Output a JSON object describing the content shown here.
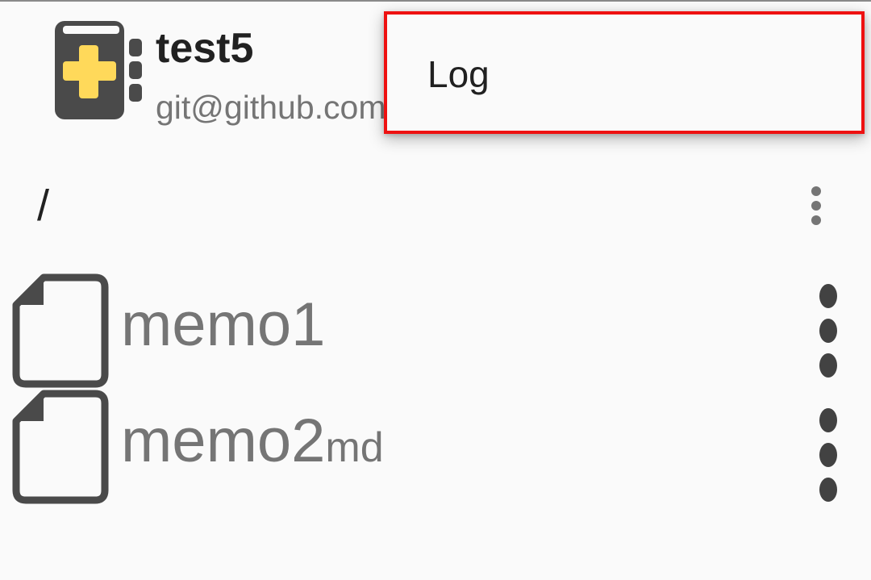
{
  "repository": {
    "name": "test5",
    "url": "git@github.com"
  },
  "path": {
    "current": "/"
  },
  "files": [
    {
      "name": "memo1",
      "ext": ""
    },
    {
      "name": "memo2",
      "ext": "md"
    }
  ],
  "popup_menu": {
    "items": [
      {
        "label": "Log"
      }
    ]
  },
  "colors": {
    "logo_yellow": "#FFD95A",
    "icon_dark": "#4a4a4a",
    "highlight_red": "#ee1111"
  },
  "icons": {
    "app_logo": "app-logo-icon",
    "file": "file-icon",
    "overflow": "more-vert-icon"
  }
}
